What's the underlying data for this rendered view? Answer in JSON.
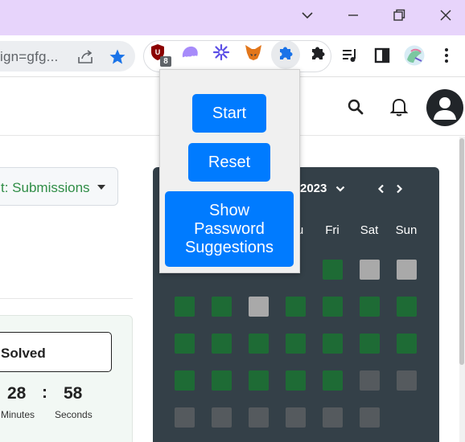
{
  "browser": {
    "url_fragment": "ign=gfg...",
    "extension_badge": "8"
  },
  "popup": {
    "start_label": "Start",
    "reset_label": "Reset",
    "suggest_label": "Show Password Suggestions"
  },
  "filter": {
    "prefix": "t: ",
    "value": "Submissions"
  },
  "potd": {
    "solved_label": "Solved",
    "minutes": "28",
    "seconds": "58",
    "colon": ":",
    "minutes_unit": "Minutes",
    "seconds_unit": "Seconds"
  },
  "calendar": {
    "month_label": "2023",
    "days": [
      "u",
      "Fri",
      "Sat",
      "Sun"
    ],
    "colors": {
      "solved": "#1e6b35",
      "missed": "#a9a9a9",
      "future": "#555a5e"
    },
    "rows": [
      [
        "hidden",
        "hidden",
        "hidden",
        "hidden",
        "solved",
        "missed",
        "missed"
      ],
      [
        "solved",
        "solved",
        "missed",
        "solved",
        "solved",
        "solved",
        "solved"
      ],
      [
        "solved",
        "solved",
        "solved",
        "solved",
        "solved",
        "solved",
        "solved"
      ],
      [
        "solved",
        "solved",
        "solved",
        "solved",
        "solved",
        "future",
        "future"
      ],
      [
        "future",
        "future",
        "future",
        "future",
        "future",
        "future",
        "empty"
      ]
    ]
  },
  "colors": {
    "accent": "#007bff",
    "brand_green": "#2f8d46",
    "titlebar": "#e7d4fb"
  }
}
